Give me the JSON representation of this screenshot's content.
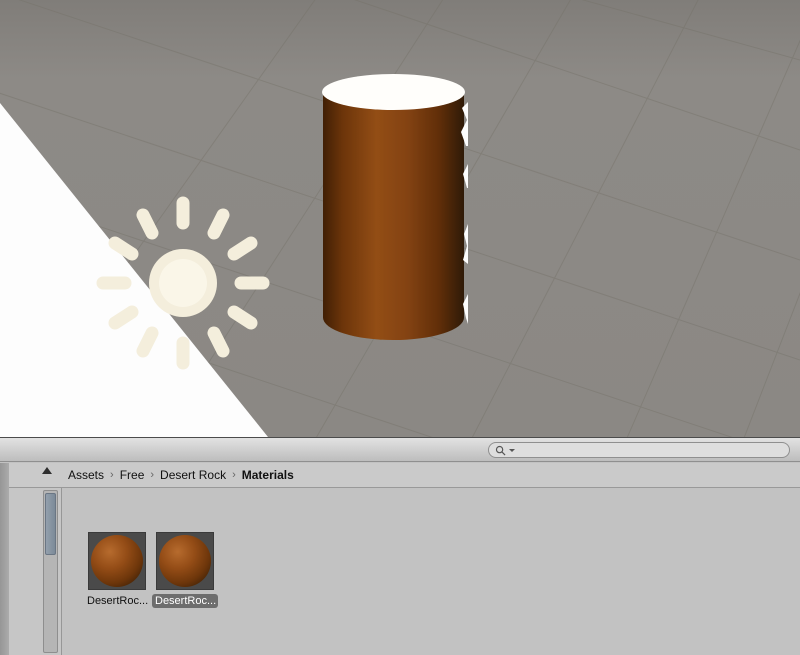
{
  "scene": {
    "name": "scene-view",
    "objects": {
      "sun_gizmo": "directional-light-sun-gizmo",
      "cylinder": "desert-rock-textured-cylinder"
    },
    "colors": {
      "background": "#8b8884",
      "grid_line": "#6f6c68",
      "skybox_white": "#fdfdfd",
      "gizmo_cream": "#f4eedc",
      "rock_orange": "#9c5514"
    }
  },
  "toolbar": {
    "search": {
      "placeholder": "",
      "value": ""
    }
  },
  "breadcrumb": {
    "separator": "›",
    "items": [
      {
        "label": "Assets"
      },
      {
        "label": "Free"
      },
      {
        "label": "Desert Rock"
      },
      {
        "label": "Materials"
      }
    ]
  },
  "assets": {
    "items": [
      {
        "label": "DesertRoc...",
        "selected": false
      },
      {
        "label": "DesertRoc...",
        "selected": true
      }
    ]
  }
}
